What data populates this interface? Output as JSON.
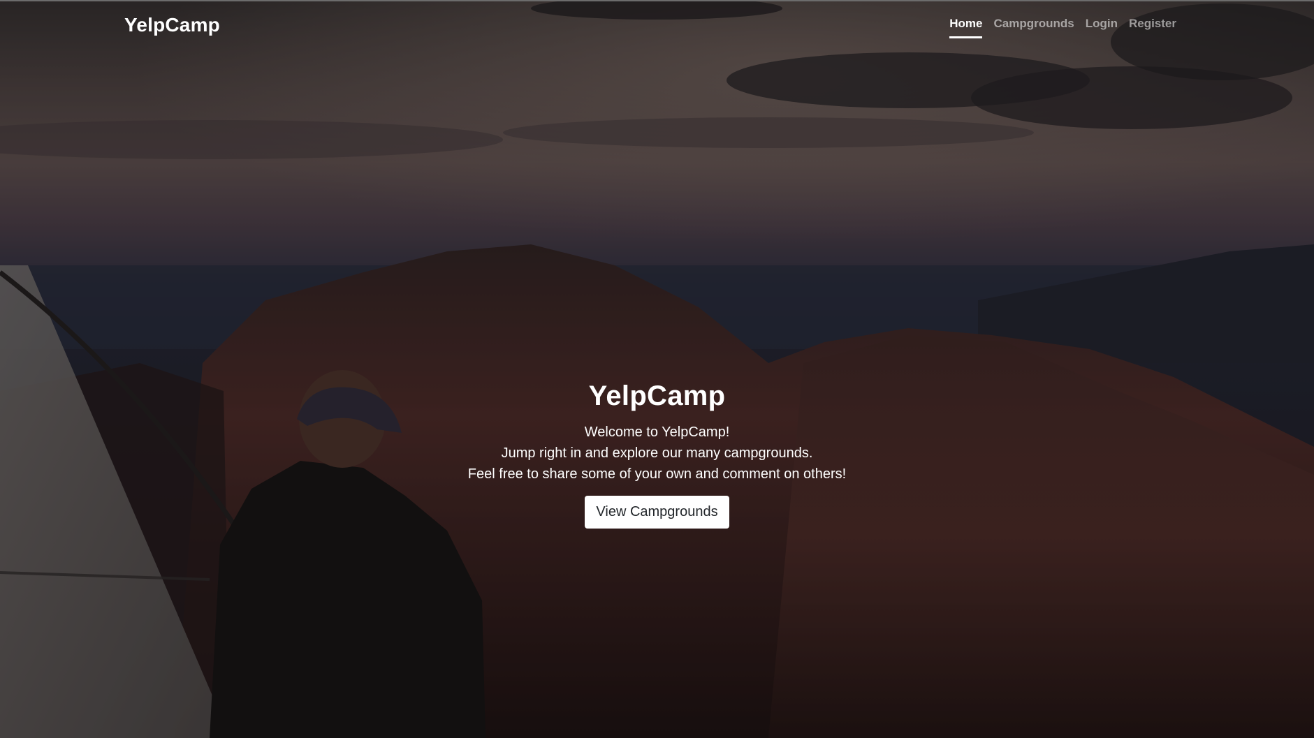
{
  "navbar": {
    "brand": "YelpCamp",
    "links": [
      {
        "label": "Home",
        "active": true
      },
      {
        "label": "Campgrounds",
        "active": false
      },
      {
        "label": "Login",
        "active": false
      },
      {
        "label": "Register",
        "active": false
      }
    ]
  },
  "hero": {
    "title": "YelpCamp",
    "lines": [
      "Welcome to YelpCamp!",
      "Jump right in and explore our many campgrounds.",
      "Feel free to share some of your own and comment on others!"
    ],
    "button_label": "View Campgrounds"
  },
  "colors": {
    "text": "#ffffff",
    "button_bg": "#ffffff",
    "button_text": "#212529"
  }
}
